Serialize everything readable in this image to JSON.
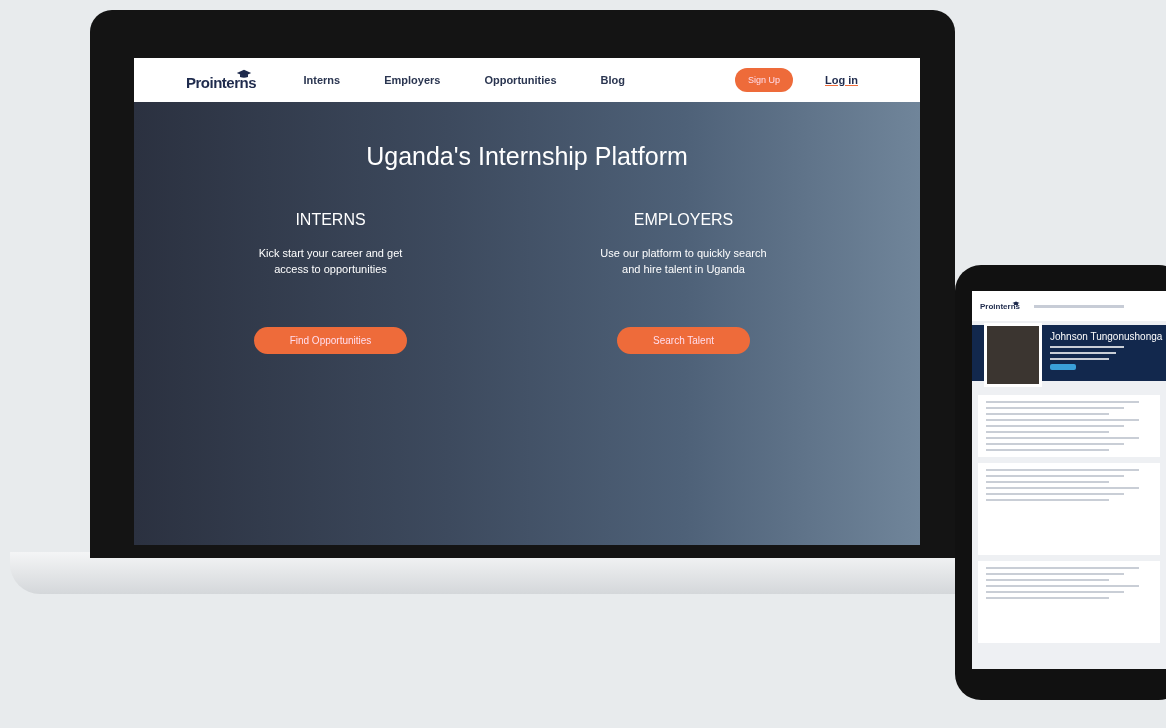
{
  "site": {
    "logo": "Prointerns",
    "nav": [
      {
        "label": "Interns"
      },
      {
        "label": "Employers"
      },
      {
        "label": "Opportunities"
      },
      {
        "label": "Blog"
      }
    ],
    "signup": "Sign Up",
    "login": "Log in"
  },
  "hero": {
    "title": "Uganda's Internship Platform",
    "columns": [
      {
        "heading": "INTERNS",
        "text": "Kick start your career and get access to opportunities",
        "button": "Find Opportunities"
      },
      {
        "heading": "EMPLOYERS",
        "text": "Use our platform to quickly search and hire talent in Uganda",
        "button": "Search Talent"
      }
    ]
  },
  "phone": {
    "logo": "Prointerns",
    "profile_name": "Johnson Tungonushonga"
  }
}
